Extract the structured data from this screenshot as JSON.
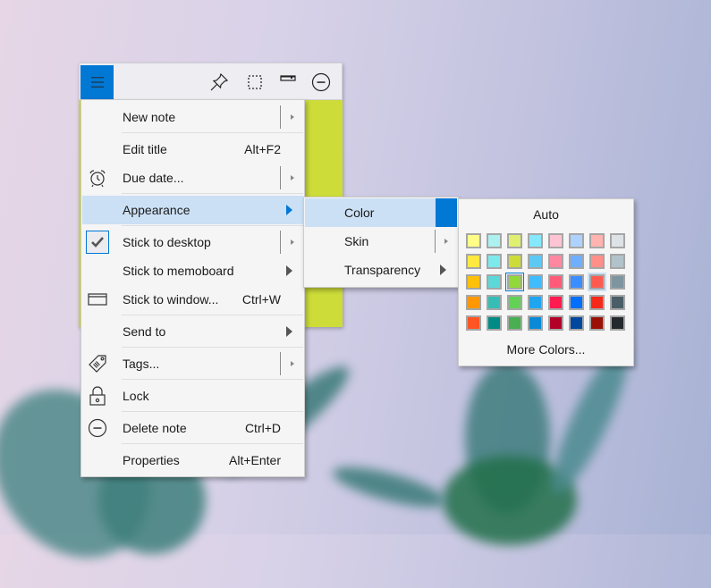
{
  "toolbar": {
    "menu_icon": "hamburger-menu-icon",
    "buttons": [
      {
        "name": "pin-icon"
      },
      {
        "name": "select-region-icon"
      },
      {
        "name": "collapse-icon"
      },
      {
        "name": "minimize-circle-icon"
      }
    ]
  },
  "note": {
    "color": "#cddc39"
  },
  "main_menu": {
    "items": [
      {
        "label": "New note",
        "shortcut": "",
        "icon": "",
        "submenu": "split"
      },
      {
        "label": "Edit title",
        "shortcut": "Alt+F2",
        "icon": "",
        "submenu": ""
      },
      {
        "label": "Due date...",
        "shortcut": "",
        "icon": "alarm-clock-icon",
        "submenu": "split"
      },
      {
        "label": "Appearance",
        "shortcut": "",
        "icon": "",
        "submenu": "arrow",
        "highlighted": true
      },
      {
        "label": "Stick to desktop",
        "shortcut": "",
        "icon": "checkmark-icon",
        "submenu": "split",
        "checked": true
      },
      {
        "label": "Stick to memoboard",
        "shortcut": "",
        "icon": "",
        "submenu": "arrow"
      },
      {
        "label": "Stick to window...",
        "shortcut": "Ctrl+W",
        "icon": "window-icon",
        "submenu": ""
      },
      {
        "label": "Send to",
        "shortcut": "",
        "icon": "",
        "submenu": "arrow"
      },
      {
        "label": "Tags...",
        "shortcut": "",
        "icon": "tag-icon",
        "submenu": "split"
      },
      {
        "label": "Lock",
        "shortcut": "",
        "icon": "lock-icon",
        "submenu": ""
      },
      {
        "label": "Delete note",
        "shortcut": "Ctrl+D",
        "icon": "minus-circle-icon",
        "submenu": ""
      },
      {
        "label": "Properties",
        "shortcut": "Alt+Enter",
        "icon": "",
        "submenu": ""
      }
    ]
  },
  "appearance_menu": {
    "items": [
      {
        "label": "Color",
        "highlighted": true
      },
      {
        "label": "Skin"
      },
      {
        "label": "Transparency"
      }
    ]
  },
  "color_panel": {
    "auto_label": "Auto",
    "more_label": "More Colors...",
    "selected_index": 18,
    "hover_index": 22,
    "swatches": [
      "#ffff88",
      "#adf0f0",
      "#e0ef6f",
      "#86e8fd",
      "#ffc4d4",
      "#aed2ff",
      "#ffb4b0",
      "#dce2e5",
      "#ffe840",
      "#7de9ed",
      "#cddc39",
      "#5cc9f5",
      "#ff88a0",
      "#70aeff",
      "#ff8f88",
      "#b2c2ca",
      "#ffc00a",
      "#5cd8d8",
      "#92d838",
      "#40bcff",
      "#ff5a7a",
      "#3a8eff",
      "#ff5a50",
      "#7e95a0",
      "#ff9800",
      "#36beb6",
      "#62d256",
      "#21a5f0",
      "#ff1a50",
      "#006eff",
      "#f5281a",
      "#4a5e68",
      "#ff5522",
      "#008c85",
      "#4aaf50",
      "#0a8ad6",
      "#b20028",
      "#00479e",
      "#9a1006",
      "#23292c"
    ]
  }
}
